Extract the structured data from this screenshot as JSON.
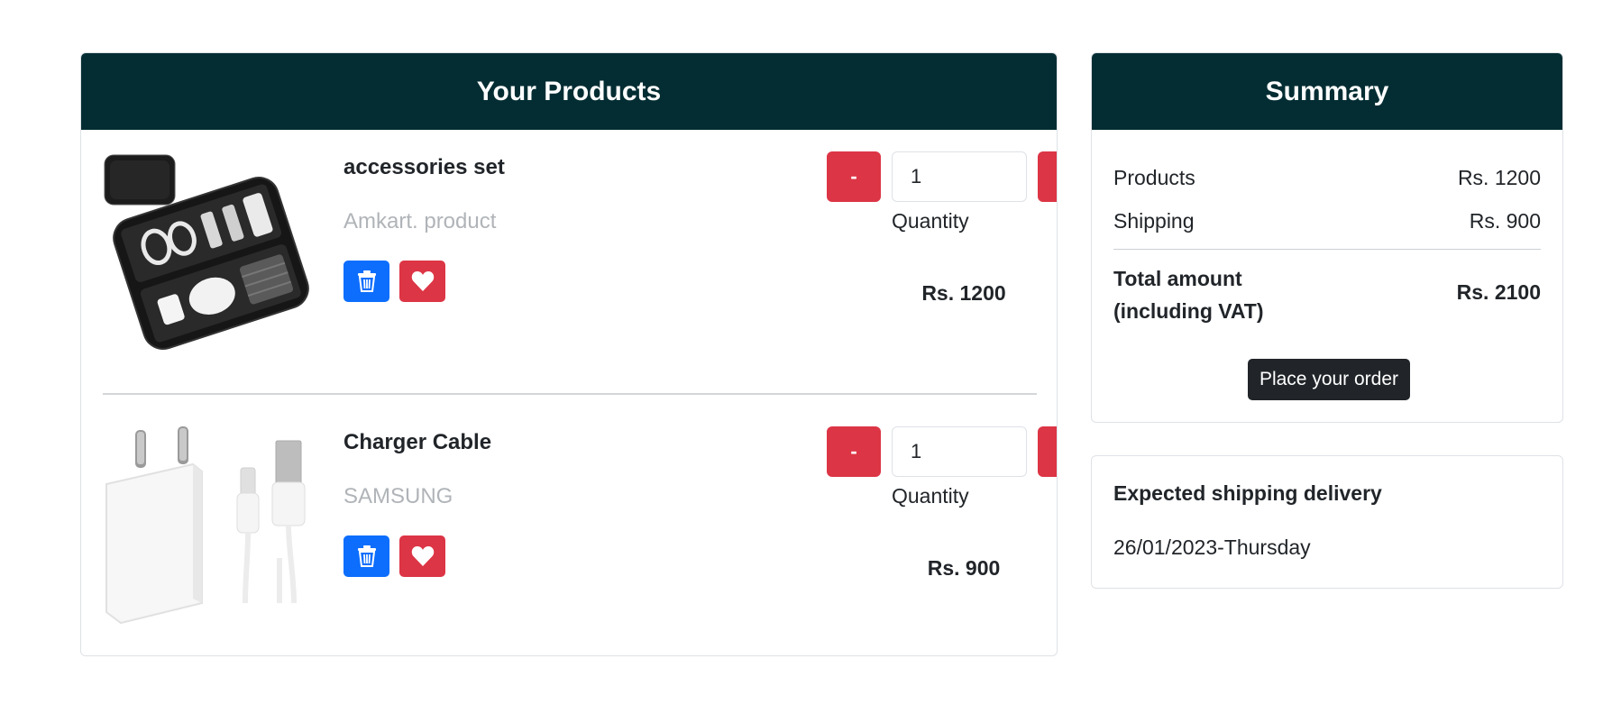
{
  "products_panel": {
    "title": "Your Products",
    "items": [
      {
        "name": "accessories set",
        "brand": "Amkart. product",
        "quantity": "1",
        "quantity_label": "Quantity",
        "price": "Rs. 1200",
        "minus_label": "-",
        "plus_label": "+",
        "image_icon": "electronics-organizer-case-image"
      },
      {
        "name": "Charger Cable",
        "brand": "SAMSUNG",
        "quantity": "1",
        "quantity_label": "Quantity",
        "price": "Rs. 900",
        "minus_label": "-",
        "plus_label": "+",
        "image_icon": "charger-adapter-cable-image"
      }
    ]
  },
  "summary": {
    "title": "Summary",
    "products_label": "Products",
    "products_value": "Rs. 1200",
    "shipping_label": "Shipping",
    "shipping_value": "Rs. 900",
    "total_label_line1": "Total amount",
    "total_label_line2": "(including VAT)",
    "total_value": "Rs. 2100",
    "order_button": "Place your order"
  },
  "delivery": {
    "title": "Expected shipping delivery",
    "date": "26/01/2023-Thursday"
  },
  "colors": {
    "header_bg": "#032d33",
    "danger": "#dc3545",
    "primary": "#0d6efd",
    "dark": "#212529"
  }
}
